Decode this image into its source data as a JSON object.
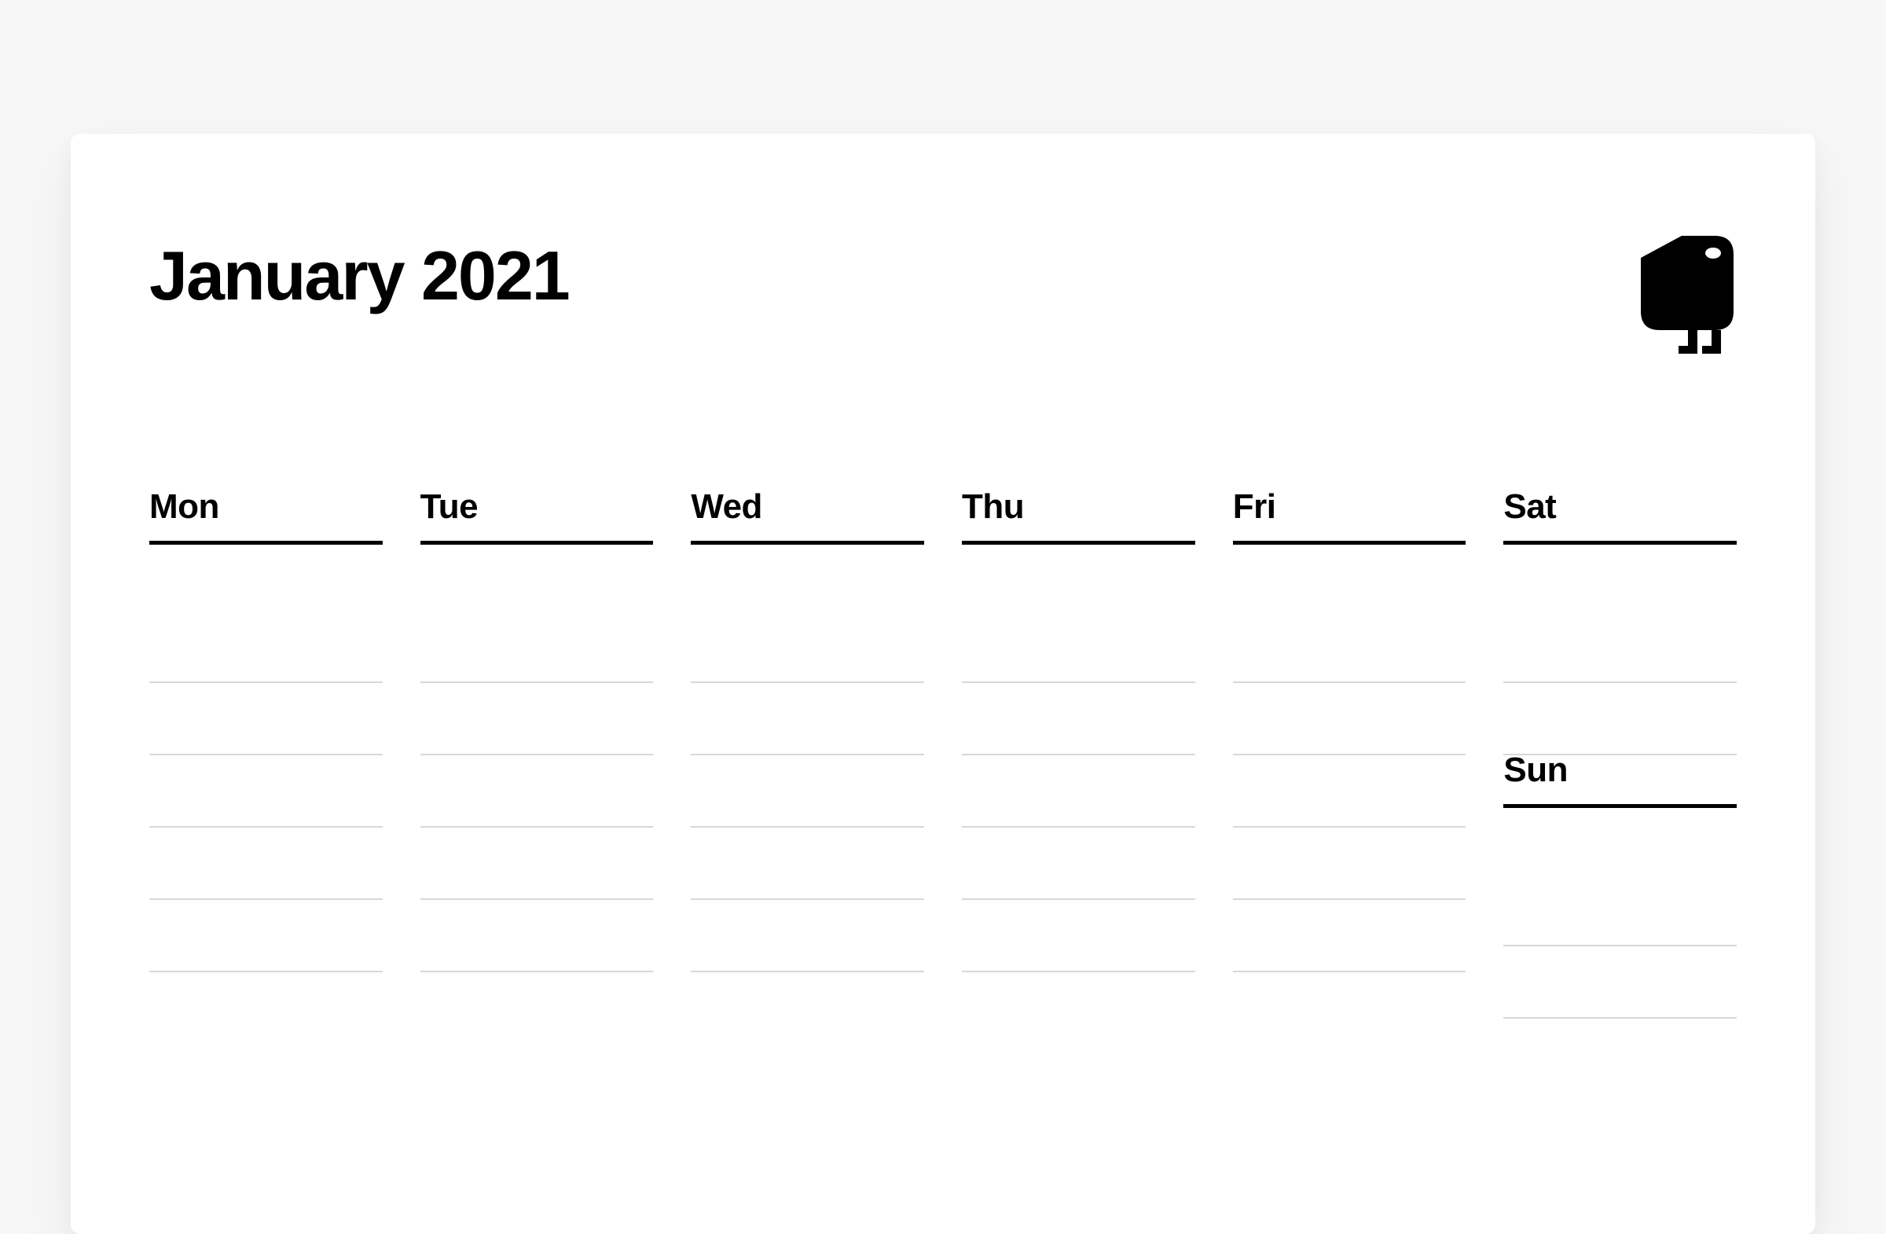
{
  "title": "January 2021",
  "days": {
    "mon": "Mon",
    "tue": "Tue",
    "wed": "Wed",
    "thu": "Thu",
    "fri": "Fri",
    "sat": "Sat",
    "sun": "Sun"
  }
}
